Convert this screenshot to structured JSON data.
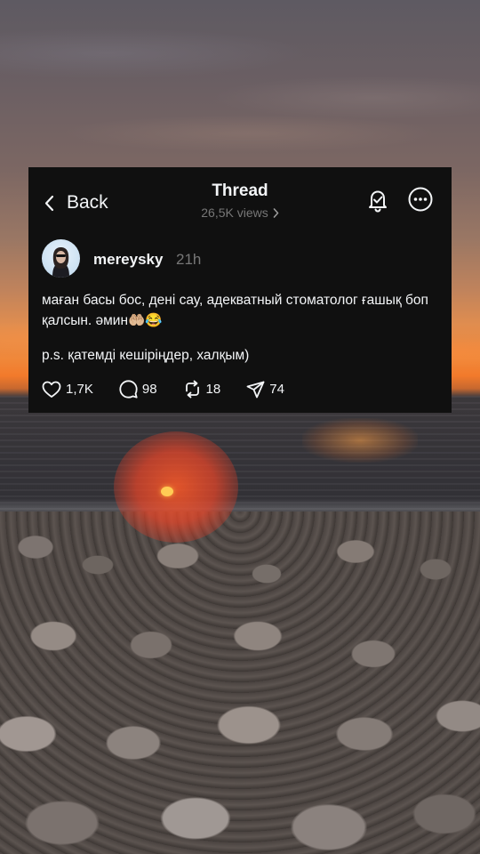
{
  "header": {
    "back_label": "Back",
    "title": "Thread",
    "views": "26,5K views"
  },
  "post": {
    "username": "mereysky",
    "time": "21h",
    "text": "маған басы бос, дені сау, адекватный стоматолог ғашық боп қалсын. әмин🤲🏼😂",
    "ps": "p.s. қатемді кешіріңдер, халқым)"
  },
  "actions": {
    "likes": "1,7K",
    "replies": "98",
    "reposts": "18",
    "shares": "74"
  },
  "icons": [
    "chevron-left-icon",
    "chevron-right-icon",
    "bell-icon",
    "more-icon",
    "heart-icon",
    "comment-icon",
    "repost-icon",
    "send-icon"
  ],
  "colors": {
    "card_bg": "#101010",
    "text": "#f3f5f7",
    "muted": "#777777"
  }
}
